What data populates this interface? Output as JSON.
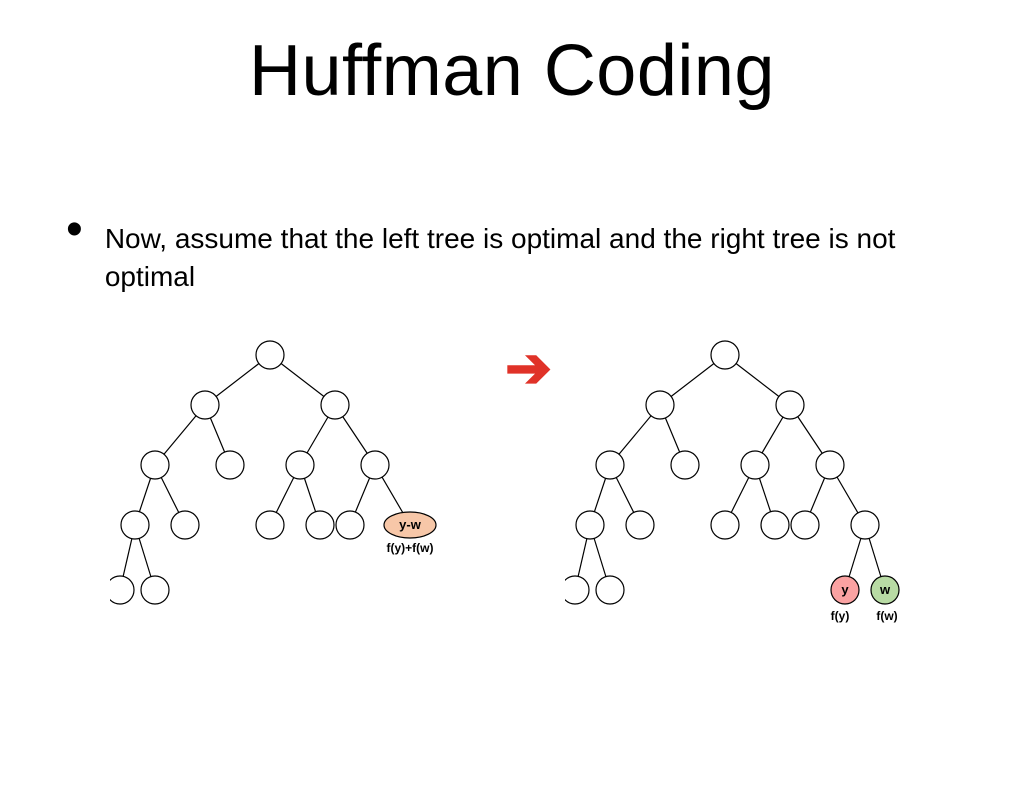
{
  "title": "Huffman Coding",
  "bullet": "Now, assume that the left tree is optimal and the right tree is not optimal",
  "leftTree": {
    "mergedNode": {
      "label": "y-w",
      "sub": "f(y)+f(w)"
    }
  },
  "rightTree": {
    "yNode": {
      "label": "y",
      "sub": "f(y)"
    },
    "wNode": {
      "label": "w",
      "sub": "f(w)"
    }
  },
  "arrowGlyph": "➔"
}
